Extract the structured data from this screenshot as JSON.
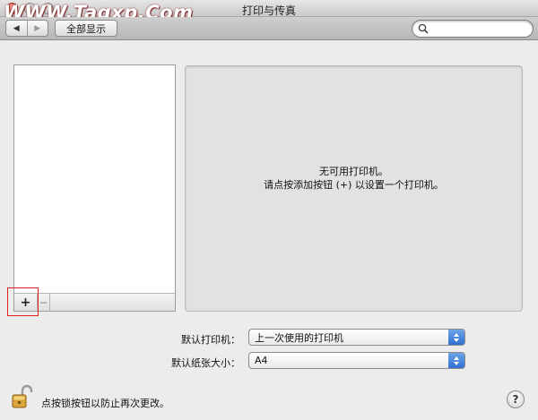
{
  "window": {
    "title": "打印与传真",
    "watermark": "WWW.Tagxp.Com"
  },
  "toolbar": {
    "back_glyph": "◀",
    "forward_glyph": "▶",
    "show_all_label": "全部显示",
    "search": {
      "value": "",
      "placeholder": ""
    }
  },
  "printer_list": {
    "items": [],
    "add_label": "+",
    "remove_label": "−"
  },
  "detail": {
    "line1": "无可用打印机。",
    "line2": "请点按添加按钮 (+) 以设置一个打印机。"
  },
  "settings": {
    "default_printer_label": "默认打印机：",
    "default_printer_value": "上一次使用的打印机",
    "default_paper_label": "默认纸张大小：",
    "default_paper_value": "A4"
  },
  "footer": {
    "lock_text": "点按锁按钮以防止再次更改。",
    "help_label": "?"
  },
  "colors": {
    "highlight": "#e02020",
    "popup_accent": "#2f6fd0"
  }
}
